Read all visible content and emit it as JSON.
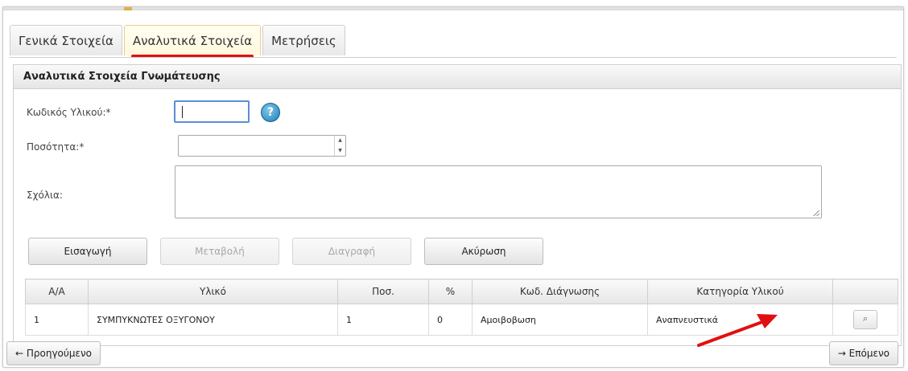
{
  "tabs": [
    {
      "label": "Γενικά Στοιχεία"
    },
    {
      "label": "Αναλυτικά Στοιχεία"
    },
    {
      "label": "Μετρήσεις"
    }
  ],
  "panel": {
    "title": "Αναλυτικά Στοιχεία Γνωμάτευσης",
    "fields": {
      "material_code_label": "Κωδικός Υλικού:*",
      "material_code_value": "",
      "help_glyph": "?",
      "quantity_label": "Ποσότητα:*",
      "quantity_value": "",
      "comments_label": "Σχόλια:",
      "comments_value": ""
    },
    "buttons": {
      "insert": "Εισαγωγή",
      "modify": "Μεταβολή",
      "delete": "Διαγραφή",
      "cancel": "Ακύρωση"
    },
    "table": {
      "headers": [
        "Α/Α",
        "Υλικό",
        "Ποσ.",
        "%",
        "Κωδ. Διάγνωσης",
        "Κατηγορία Υλικού",
        ""
      ],
      "rows": [
        [
          "1",
          "ΣΥΜΠΥΚΝΩΤΕΣ ΟΞΥΓΟΝΟΥ",
          "1",
          "0",
          "Αμοιβοβωση",
          "Αναπνευστικά",
          ""
        ]
      ],
      "view_glyph": "⌕"
    }
  },
  "navigation": {
    "prev": "← Προηγούμενο",
    "next": "→ Επόμενο"
  },
  "colors": {
    "annotation_arrow": "#e01010",
    "active_tab_underline": "#e01010",
    "help_icon": "#1e7fb5"
  },
  "icons": {
    "help": "help-icon",
    "view": "magnifier-icon",
    "spinner": "spinner-arrows-icon"
  }
}
